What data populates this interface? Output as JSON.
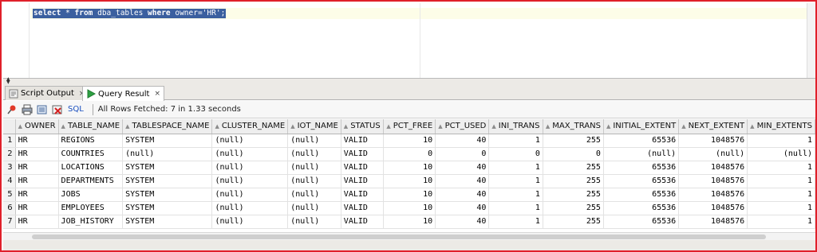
{
  "editor": {
    "sql_parts": [
      {
        "text": "select",
        "kw": true
      },
      {
        "text": " * ",
        "kw": false
      },
      {
        "text": "from",
        "kw": true
      },
      {
        "text": " dba_tables ",
        "kw": false
      },
      {
        "text": "where",
        "kw": true
      },
      {
        "text": " owner=",
        "kw": false
      },
      {
        "text": "'HR'",
        "kw": false
      },
      {
        "text": ";",
        "kw": false
      }
    ]
  },
  "tabs": [
    {
      "label": "Script Output",
      "close": "×",
      "icon": "script-output-icon",
      "active": false
    },
    {
      "label": "Query Result",
      "close": "×",
      "icon": "run-triangle-icon",
      "active": true
    }
  ],
  "toolbar": {
    "icons": [
      "pin-icon",
      "print-icon",
      "export-icon",
      "delete-icon"
    ],
    "sql_label": "SQL",
    "status": "All Rows Fetched: 7 in 1.33 seconds"
  },
  "grid": {
    "columns": [
      "OWNER",
      "TABLE_NAME",
      "TABLESPACE_NAME",
      "CLUSTER_NAME",
      "IOT_NAME",
      "STATUS",
      "PCT_FREE",
      "PCT_USED",
      "INI_TRANS",
      "MAX_TRANS",
      "INITIAL_EXTENT",
      "NEXT_EXTENT",
      "MIN_EXTENTS"
    ],
    "numeric_columns": [
      6,
      7,
      8,
      9,
      10,
      11,
      12
    ],
    "rows": [
      [
        "1",
        "HR",
        "REGIONS",
        "SYSTEM",
        "(null)",
        "(null)",
        "VALID",
        "10",
        "40",
        "1",
        "255",
        "65536",
        "1048576",
        "1"
      ],
      [
        "2",
        "HR",
        "COUNTRIES",
        "(null)",
        "(null)",
        "(null)",
        "VALID",
        "0",
        "0",
        "0",
        "0",
        "(null)",
        "(null)",
        "(null)"
      ],
      [
        "3",
        "HR",
        "LOCATIONS",
        "SYSTEM",
        "(null)",
        "(null)",
        "VALID",
        "10",
        "40",
        "1",
        "255",
        "65536",
        "1048576",
        "1"
      ],
      [
        "4",
        "HR",
        "DEPARTMENTS",
        "SYSTEM",
        "(null)",
        "(null)",
        "VALID",
        "10",
        "40",
        "1",
        "255",
        "65536",
        "1048576",
        "1"
      ],
      [
        "5",
        "HR",
        "JOBS",
        "SYSTEM",
        "(null)",
        "(null)",
        "VALID",
        "10",
        "40",
        "1",
        "255",
        "65536",
        "1048576",
        "1"
      ],
      [
        "6",
        "HR",
        "EMPLOYEES",
        "SYSTEM",
        "(null)",
        "(null)",
        "VALID",
        "10",
        "40",
        "1",
        "255",
        "65536",
        "1048576",
        "1"
      ],
      [
        "7",
        "HR",
        "JOB_HISTORY",
        "SYSTEM",
        "(null)",
        "(null)",
        "VALID",
        "10",
        "40",
        "1",
        "255",
        "65536",
        "1048576",
        "1"
      ]
    ]
  },
  "colors": {
    "frame_border": "#e0202a",
    "selection": "#3a5f9f",
    "run_icon": "#2ea043"
  }
}
